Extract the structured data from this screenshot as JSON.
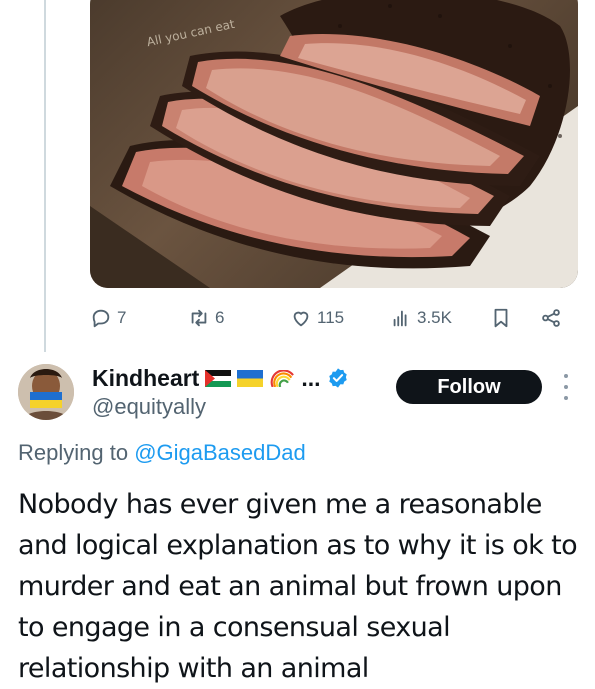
{
  "media": {
    "caption": "All you can eat"
  },
  "actions": {
    "reply_count": "7",
    "retweet_count": "6",
    "like_count": "115",
    "view_count": "3.5K"
  },
  "reply": {
    "display_name": "Kindheart",
    "name_suffix": "...",
    "handle": "@equityally",
    "follow_label": "Follow",
    "replying_prefix": "Replying to",
    "replying_to": "@GigaBasedDad",
    "text": "Nobody has ever given me a reasonable and logical explanation as to why it is ok to murder and eat an animal but frown upon to engage in a consensual sexual relationship with an animal"
  },
  "colors": {
    "accent": "#1d9bf0",
    "muted": "#536471",
    "text": "#0f1419"
  }
}
